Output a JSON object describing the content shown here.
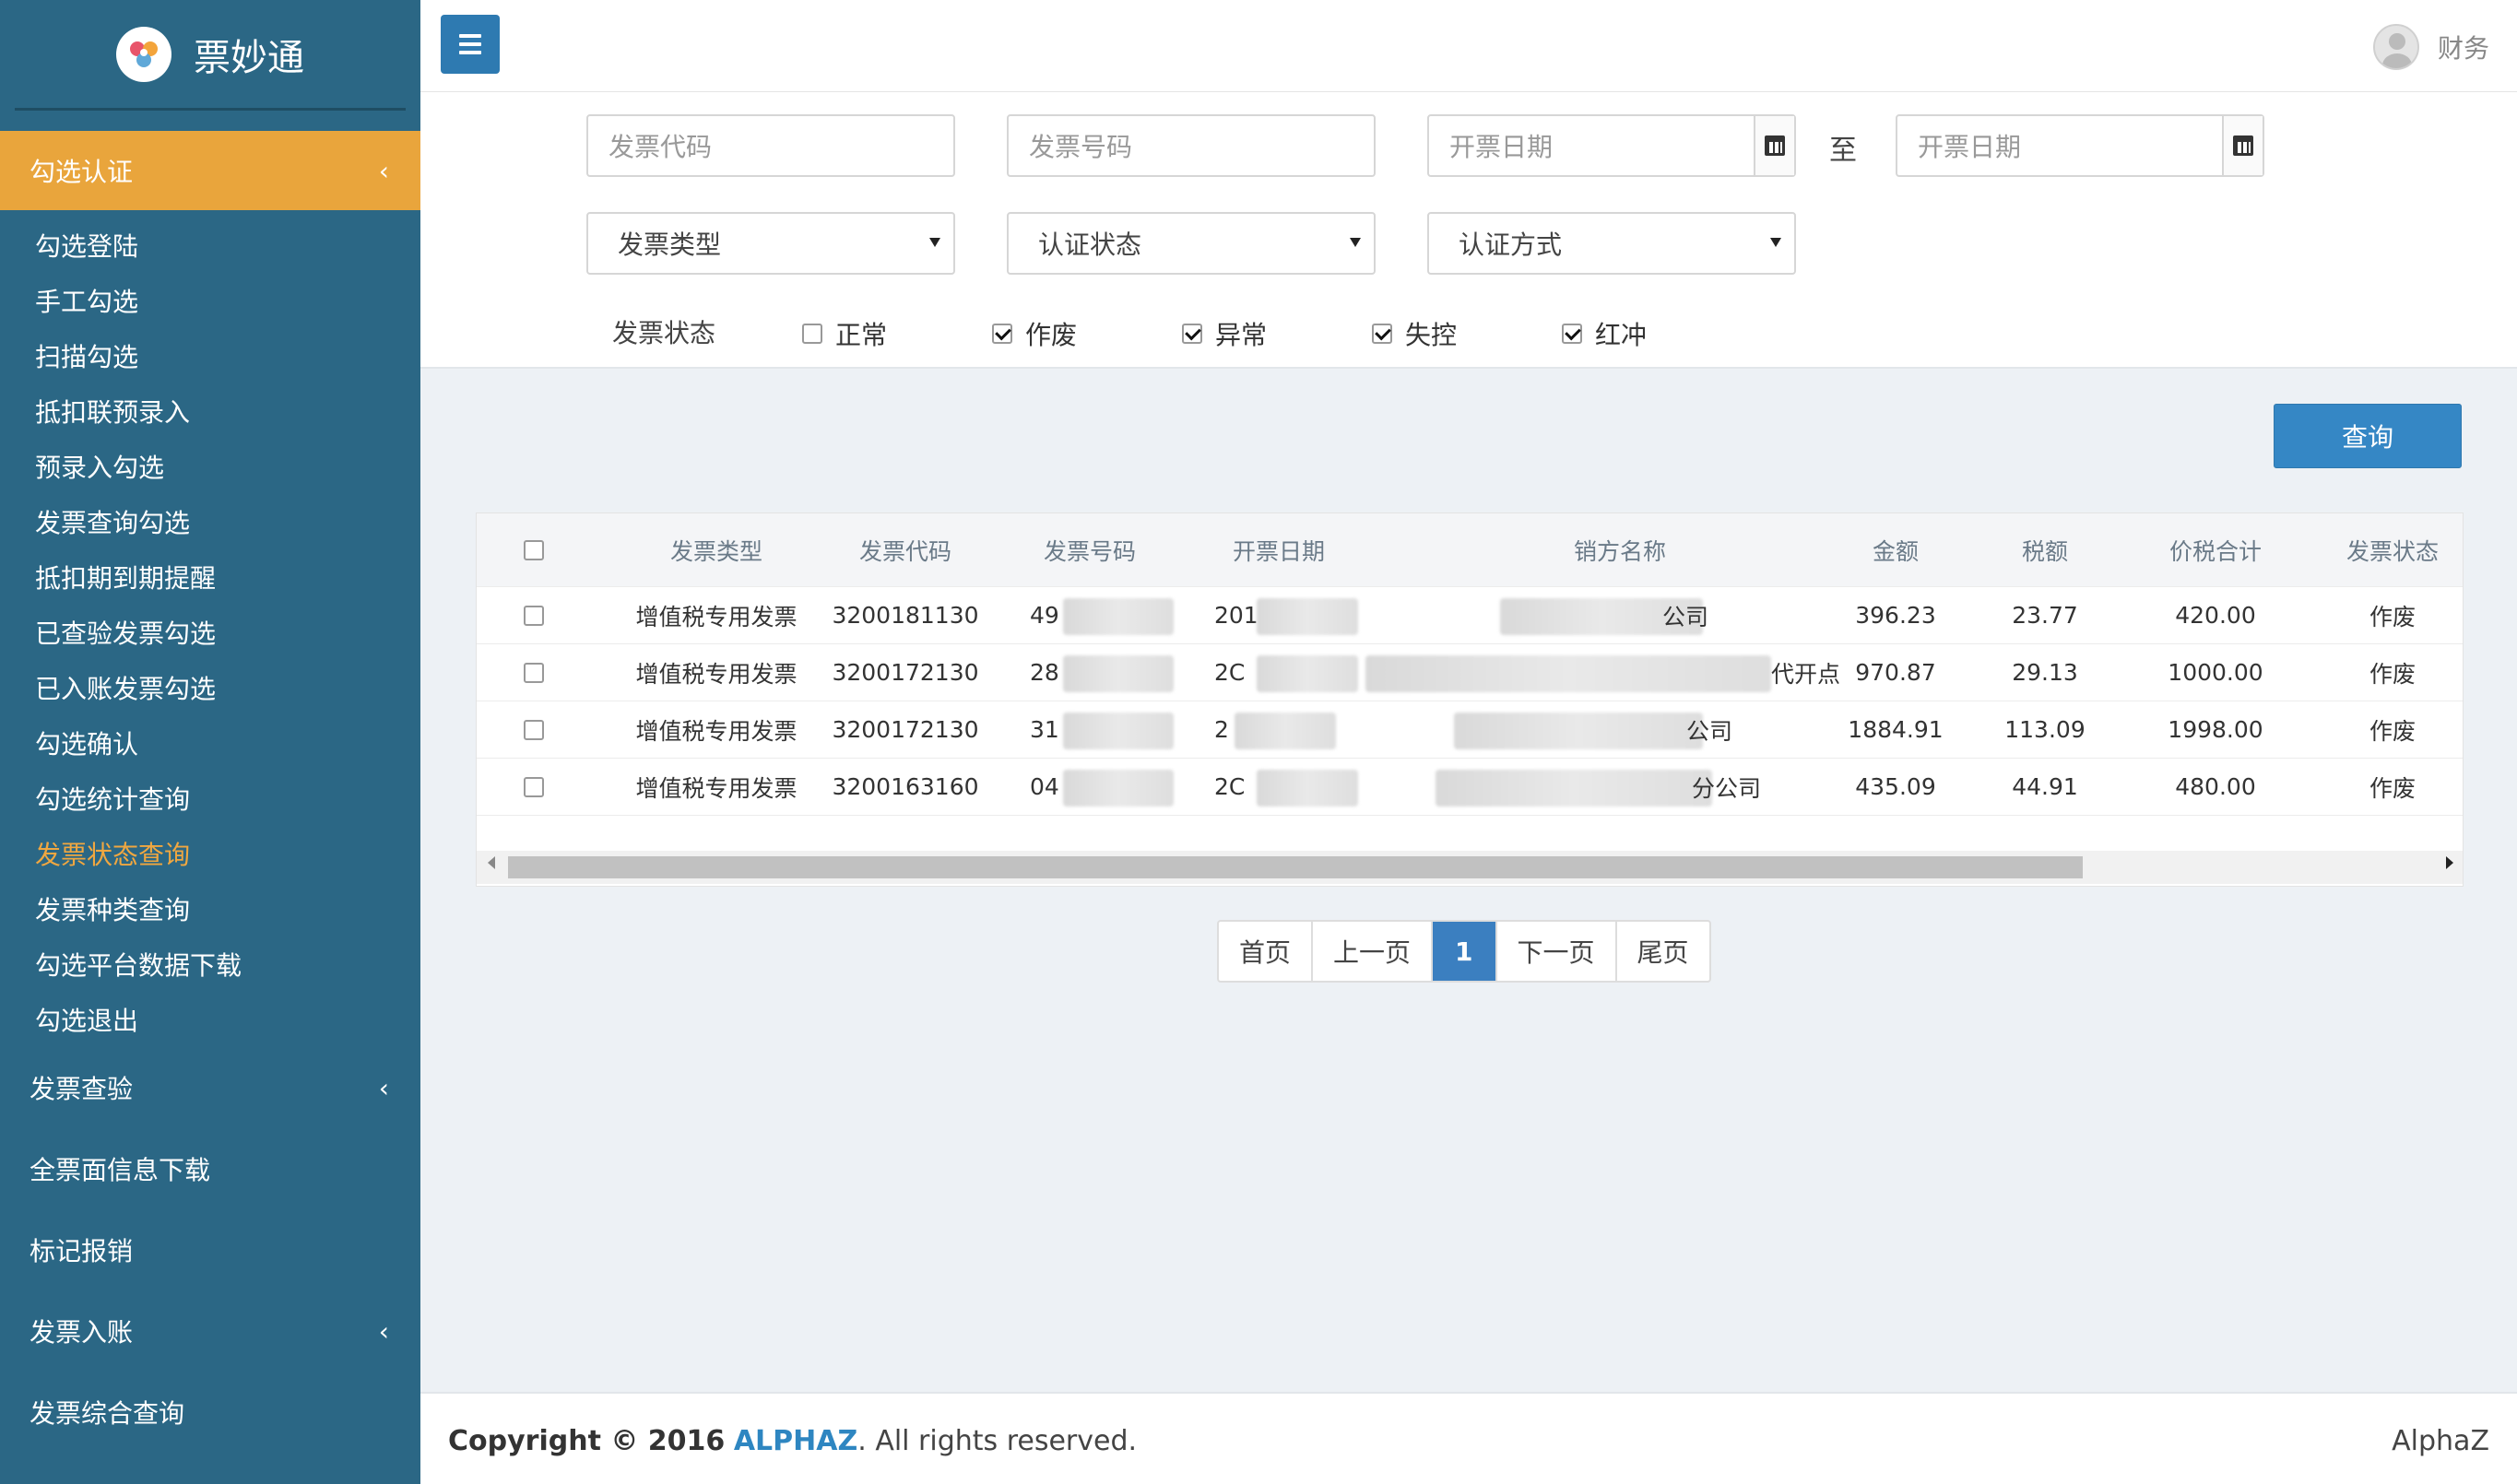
{
  "app": {
    "name": "票妙通"
  },
  "user": {
    "name": "财务"
  },
  "sidebar": {
    "active_group": "勾选认证",
    "sub_items": [
      "勾选登陆",
      "手工勾选",
      "扫描勾选",
      "抵扣联预录入",
      "预录入勾选",
      "发票查询勾选",
      "抵扣期到期提醒",
      "已查验发票勾选",
      "已入账发票勾选",
      "勾选确认",
      "勾选统计查询",
      "发票状态查询",
      "发票种类查询",
      "勾选平台数据下载",
      "勾选退出"
    ],
    "active_sub": "发票状态查询",
    "groups": [
      "发票查验",
      "全票面信息下载",
      "标记报销",
      "发票入账",
      "发票综合查询"
    ]
  },
  "filters": {
    "invoice_code_placeholder": "发票代码",
    "invoice_number_placeholder": "发票号码",
    "date_from_placeholder": "开票日期",
    "to_label": "至",
    "date_to_placeholder": "开票日期",
    "invoice_type": "发票类型",
    "cert_status": "认证状态",
    "cert_method": "认证方式",
    "status_label": "发票状态",
    "statuses": [
      {
        "label": "正常",
        "checked": false
      },
      {
        "label": "作废",
        "checked": true
      },
      {
        "label": "异常",
        "checked": true
      },
      {
        "label": "失控",
        "checked": true
      },
      {
        "label": "红冲",
        "checked": true
      }
    ]
  },
  "query_button": "查询",
  "table": {
    "headers": [
      "发票类型",
      "发票代码",
      "发票号码",
      "开票日期",
      "销方名称",
      "金额",
      "税额",
      "价税合计",
      "发票状态"
    ],
    "rows": [
      {
        "type": "增值税专用发票",
        "code": "3200181130",
        "number": "49",
        "date": "201",
        "seller": "公司",
        "amount": "396.23",
        "tax": "23.77",
        "total": "420.00",
        "status": "作废"
      },
      {
        "type": "增值税专用发票",
        "code": "3200172130",
        "number": "28",
        "date": "2C",
        "seller": "代开点",
        "amount": "970.87",
        "tax": "29.13",
        "total": "1000.00",
        "status": "作废"
      },
      {
        "type": "增值税专用发票",
        "code": "3200172130",
        "number": "31",
        "date": "2",
        "seller": "公司",
        "amount": "1884.91",
        "tax": "113.09",
        "total": "1998.00",
        "status": "作废"
      },
      {
        "type": "增值税专用发票",
        "code": "3200163160",
        "number": "04",
        "date": "2C",
        "seller": "分公司",
        "amount": "435.09",
        "tax": "44.91",
        "total": "480.00",
        "status": "作废"
      }
    ]
  },
  "pagination": {
    "first": "首页",
    "prev": "上一页",
    "current": "1",
    "next": "下一页",
    "last": "尾页"
  },
  "footer": {
    "copyright_prefix": "Copyright © 2016",
    "brand": "ALPHAZ",
    "copyright_suffix": ". All rights reserved.",
    "right": "AlphaZ"
  }
}
